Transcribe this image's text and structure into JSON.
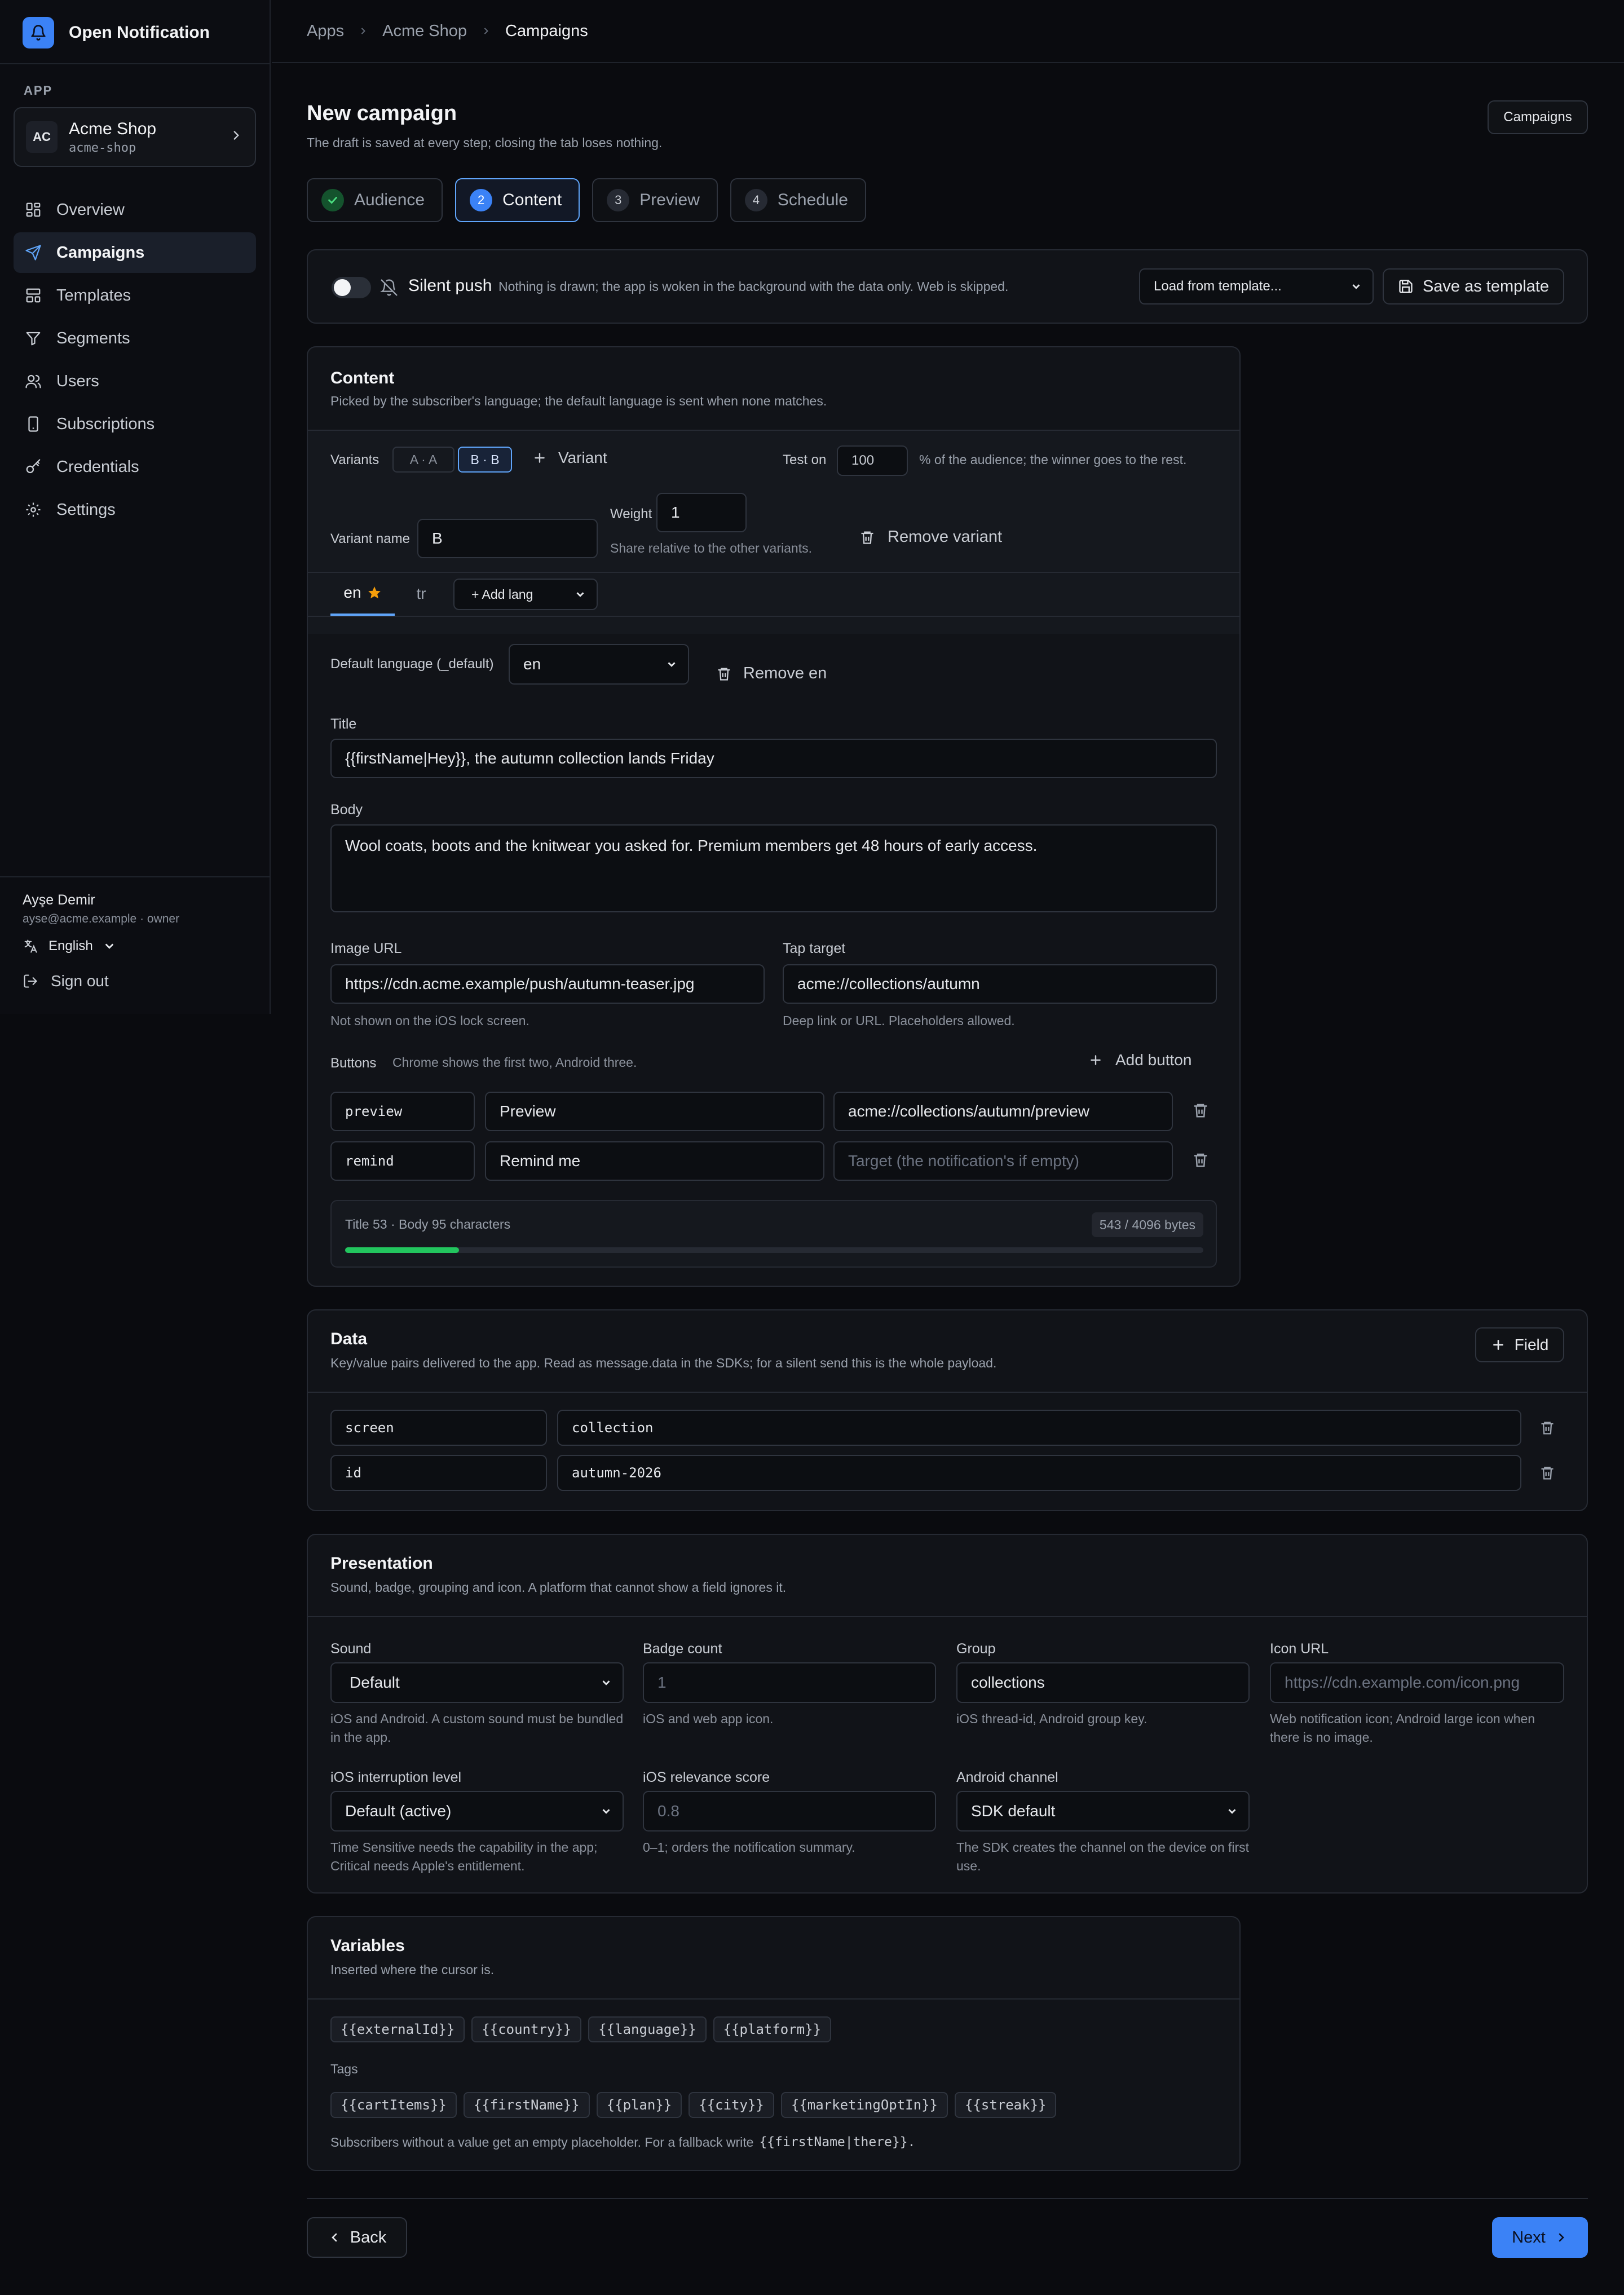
{
  "brand": {
    "name": "Open Notification"
  },
  "sidebar": {
    "app_label": "APP",
    "app": {
      "initials": "AC",
      "name": "Acme Shop",
      "slug": "acme-shop"
    },
    "nav": [
      {
        "label": "Overview",
        "icon": "grid-icon"
      },
      {
        "label": "Campaigns",
        "icon": "send-icon",
        "active": true
      },
      {
        "label": "Templates",
        "icon": "layout-icon"
      },
      {
        "label": "Segments",
        "icon": "filter-icon"
      },
      {
        "label": "Users",
        "icon": "users-icon"
      },
      {
        "label": "Subscriptions",
        "icon": "phone-icon"
      },
      {
        "label": "Credentials",
        "icon": "key-icon"
      },
      {
        "label": "Settings",
        "icon": "gear-icon"
      }
    ],
    "user": {
      "name": "Ayşe Demir",
      "meta": "ayse@acme.example · owner"
    },
    "language": "English",
    "sign_out": "Sign out"
  },
  "breadcrumb": [
    "Apps",
    "Acme Shop",
    "Campaigns"
  ],
  "page": {
    "title": "New campaign",
    "subtitle": "The draft is saved at every step; closing the tab loses nothing.",
    "campaigns_button": "Campaigns"
  },
  "steps": [
    {
      "num": "1",
      "label": "Audience",
      "state": "done"
    },
    {
      "num": "2",
      "label": "Content",
      "state": "active"
    },
    {
      "num": "3",
      "label": "Preview",
      "state": "todo"
    },
    {
      "num": "4",
      "label": "Schedule",
      "state": "todo"
    }
  ],
  "silent": {
    "label": "Silent push",
    "desc": "Nothing is drawn; the app is woken in the background with the data only. Web is skipped.",
    "enabled": false,
    "template_select": "Load from template...",
    "save_template": "Save as template"
  },
  "content": {
    "title": "Content",
    "desc": "Picked by the subscriber's language; the default language is sent when none matches.",
    "variants_label": "Variants",
    "variants": [
      "A · A",
      "B · B"
    ],
    "active_variant": "B · B",
    "add_variant": "Variant",
    "test_on_label": "Test on",
    "test_on_value": "100",
    "test_on_suffix": "% of the audience; the winner goes to the rest.",
    "variant_name_label": "Variant name",
    "variant_name": "B",
    "weight_label": "Weight",
    "weight": "1",
    "weight_hint": "Share relative to the other variants.",
    "remove_variant": "Remove variant",
    "lang_tabs": [
      "en",
      "tr"
    ],
    "add_language": "+ Add lang",
    "default_lang_label": "Default language (_default)",
    "default_lang": "en",
    "remove_lang": "Remove en",
    "title_label": "Title",
    "title_value": "{{firstName|Hey}}, the autumn collection lands Friday",
    "body_label": "Body",
    "body_value": "Wool coats, boots and the knitwear you asked for. Premium members get 48 hours of early access.",
    "image_label": "Image URL",
    "image_value": "https://cdn.acme.example/push/autumn-teaser.jpg",
    "image_hint": "Not shown on the iOS lock screen.",
    "tap_label": "Tap target",
    "tap_value": "acme://collections/autumn",
    "tap_hint": "Deep link or URL. Placeholders allowed.",
    "buttons_label": "Buttons",
    "buttons_hint": "Chrome shows the first two, Android three.",
    "add_button": "Add button",
    "buttons": [
      {
        "id": "preview",
        "label": "Preview",
        "target": "acme://collections/autumn/preview",
        "target_placeholder": ""
      },
      {
        "id": "remind",
        "label": "Remind me",
        "target": "",
        "target_placeholder": "Target (the notification's if empty)"
      }
    ],
    "counts": "Title 53 · Body 95 characters",
    "bytes": "543 / 4096 bytes",
    "bytes_used": 543,
    "bytes_max": 4096
  },
  "data_panel": {
    "title": "Data",
    "desc": "Key/value pairs delivered to the app. Read as message.data in the SDKs; for a silent send this is the whole payload.",
    "add_field": "Field",
    "rows": [
      {
        "key": "screen",
        "value": "collection"
      },
      {
        "key": "id",
        "value": "autumn-2026"
      }
    ]
  },
  "presentation": {
    "title": "Presentation",
    "desc": "Sound, badge, grouping and icon. A platform that cannot show a field ignores it.",
    "sound_label": "Sound",
    "sound_value": "Default",
    "sound_hint": "iOS and Android. A custom sound must be bundled in the app.",
    "badge_label": "Badge count",
    "badge_placeholder": "1",
    "badge_hint": "iOS and web app icon.",
    "group_label": "Group",
    "group_value": "collections",
    "group_hint": "iOS thread-id, Android group key.",
    "icon_label": "Icon URL",
    "icon_placeholder": "https://cdn.example.com/icon.png",
    "icon_hint": "Web notification icon; Android large icon when there is no image.",
    "interruption_label": "iOS interruption level",
    "interruption_value": "Default (active)",
    "interruption_hint": "Time Sensitive needs the capability in the app; Critical needs Apple's entitlement.",
    "relevance_label": "iOS relevance score",
    "relevance_placeholder": "0.8",
    "relevance_hint": "0–1; orders the notification summary.",
    "channel_label": "Android channel",
    "channel_value": "SDK default",
    "channel_hint": "The SDK creates the channel on the device on first use."
  },
  "variables": {
    "title": "Variables",
    "desc": "Inserted where the cursor is.",
    "system": [
      "{{externalId}}",
      "{{country}}",
      "{{language}}",
      "{{platform}}"
    ],
    "tags_label": "Tags",
    "tags": [
      "{{cartItems}}",
      "{{firstName}}",
      "{{plan}}",
      "{{city}}",
      "{{marketingOptIn}}",
      "{{streak}}"
    ],
    "footer_text": "Subscribers without a value get an empty placeholder. For a fallback write",
    "footer_code": "{{firstName|there}}."
  },
  "footer": {
    "back": "Back",
    "next": "Next"
  },
  "colors": {
    "accent": "#3b82f6",
    "success": "#22c55e",
    "star": "#f59e0b"
  }
}
